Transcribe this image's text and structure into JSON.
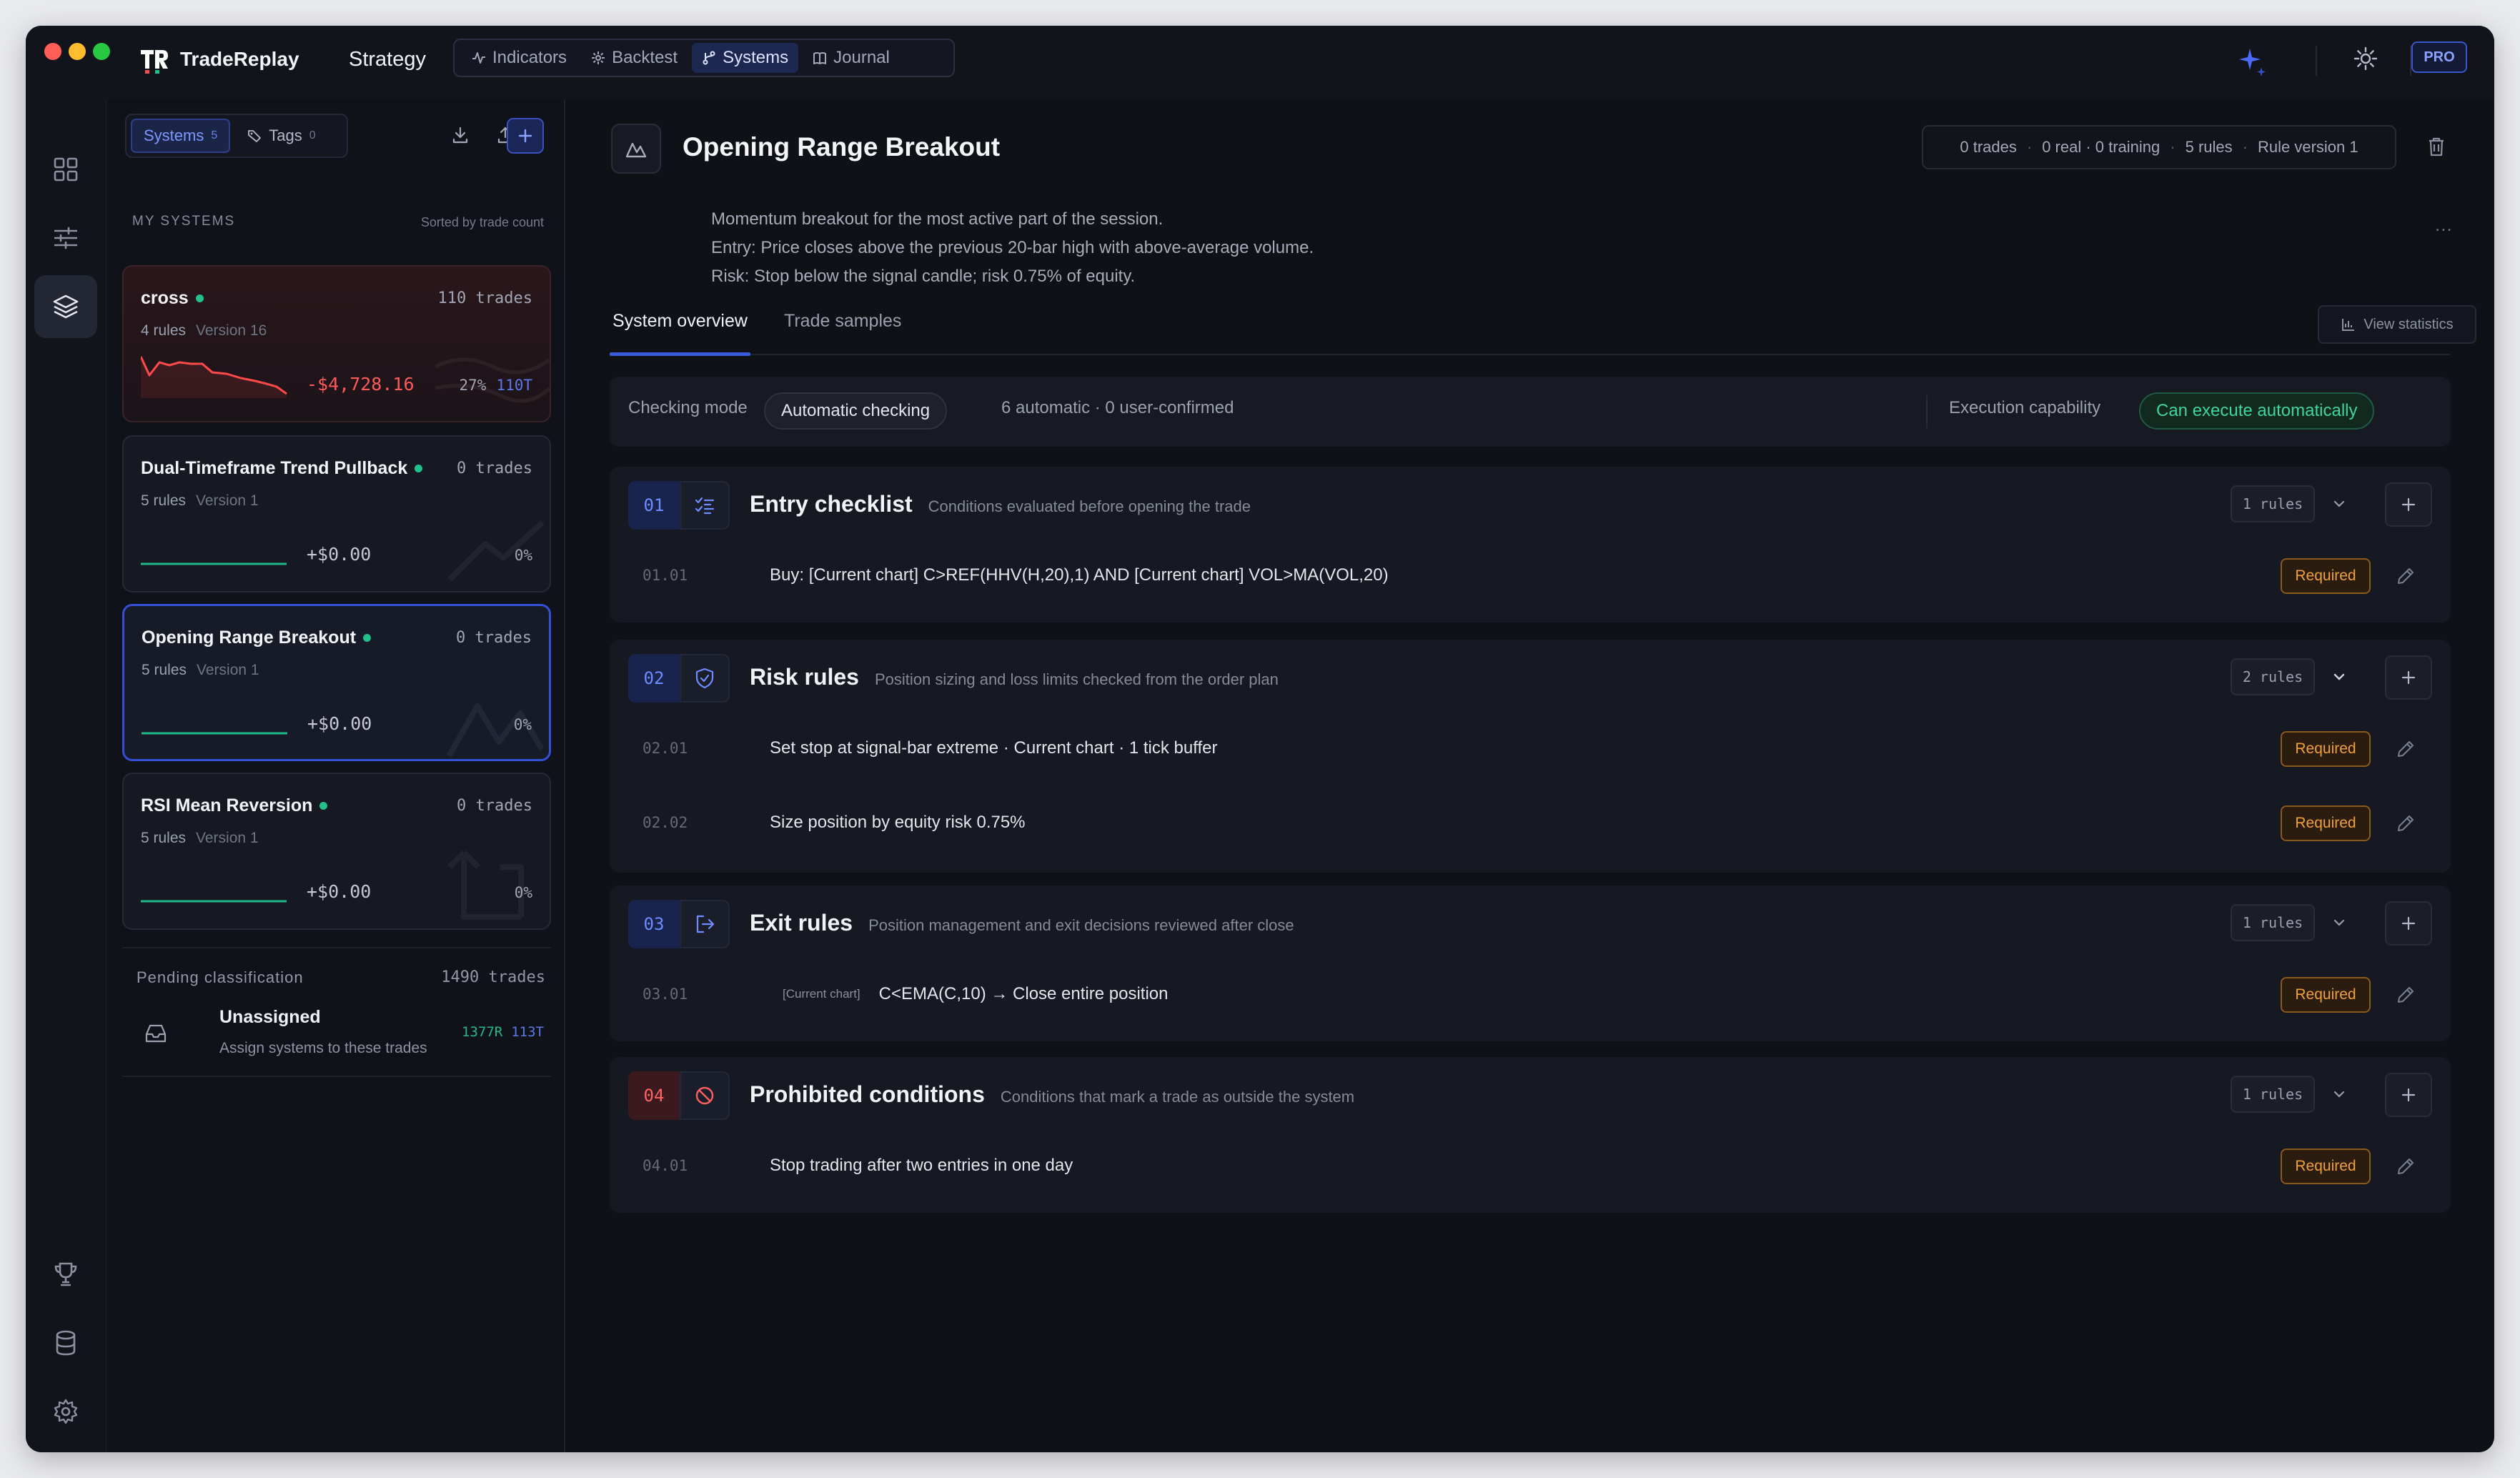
{
  "app": {
    "brand": "TradeReplay",
    "section": "Strategy",
    "badge": "PRO"
  },
  "nav": {
    "tabs": [
      {
        "label": "Indicators",
        "icon": "activity-icon"
      },
      {
        "label": "Backtest",
        "icon": "settings-spark-icon"
      },
      {
        "label": "Systems",
        "icon": "branch-icon",
        "active": true
      },
      {
        "label": "Journal",
        "icon": "book-icon"
      }
    ]
  },
  "sidebar": {
    "tabs": [
      {
        "label": "Systems",
        "count": "5",
        "active": true
      },
      {
        "label": "Tags",
        "count": "0"
      }
    ],
    "heading": "MY SYSTEMS",
    "sort_label": "Sorted by trade count",
    "systems": [
      {
        "name": "cross",
        "trades": "110 trades",
        "rules": "4 rules",
        "version": "Version 16",
        "pnl": "-$4,728.16",
        "pct": "27%",
        "tcount": "110T",
        "state": "loss"
      },
      {
        "name": "Dual-Timeframe Trend Pullback",
        "trades": "0 trades",
        "rules": "5 rules",
        "version": "Version 1",
        "pnl": "+$0.00",
        "pct": "0%",
        "state": "flat"
      },
      {
        "name": "Opening Range Breakout",
        "trades": "0 trades",
        "rules": "5 rules",
        "version": "Version 1",
        "pnl": "+$0.00",
        "pct": "0%",
        "state": "selected"
      },
      {
        "name": "RSI Mean Reversion",
        "trades": "0 trades",
        "rules": "5 rules",
        "version": "Version 1",
        "pnl": "+$0.00",
        "pct": "0%",
        "state": "flat"
      }
    ],
    "pending": {
      "label": "Pending classification",
      "count": "1490 trades",
      "title": "Unassigned",
      "subtitle": "Assign systems to these trades",
      "real": "1377R",
      "training": "113T"
    }
  },
  "main": {
    "title": "Opening Range Breakout",
    "meta": [
      "0 trades",
      "0 real · 0 training",
      "5 rules",
      "Rule version 1"
    ],
    "meta_sep": "·",
    "description": [
      "Momentum breakout for the most active part of the session.",
      "Entry: Price closes above the previous 20-bar high with above-average volume.",
      "Risk: Stop below the signal candle; risk 0.75% of equity."
    ],
    "more": "...",
    "tabs": [
      "System overview",
      "Trade samples"
    ],
    "view_stats": "View statistics",
    "mode": {
      "label": "Checking mode",
      "value": "Automatic checking",
      "counts": "6 automatic · 0 user-confirmed",
      "exec_label": "Execution capability",
      "exec_value": "Can execute automatically"
    },
    "sections": [
      {
        "num": "01",
        "title": "Entry checklist",
        "subtitle": "Conditions evaluated before opening the trade",
        "count": "1 rules",
        "icon": "checklist-icon",
        "rules": [
          {
            "num": "01.01",
            "text": "Buy: [Current chart] C>REF(HHV(H,20),1) AND [Current chart] VOL>MA(VOL,20)",
            "badge": "Required"
          }
        ]
      },
      {
        "num": "02",
        "title": "Risk rules",
        "subtitle": "Position sizing and loss limits checked from the order plan",
        "count": "2 rules",
        "icon": "shield-icon",
        "rules": [
          {
            "num": "02.01",
            "text": "Set stop at signal-bar extreme · Current chart · 1 tick buffer",
            "badge": "Required"
          },
          {
            "num": "02.02",
            "text": "Size position by equity risk 0.75%",
            "badge": "Required"
          }
        ]
      },
      {
        "num": "03",
        "title": "Exit rules",
        "subtitle": "Position management and exit decisions reviewed after close",
        "count": "1 rules",
        "icon": "exit-icon",
        "rules": [
          {
            "num": "03.01",
            "tag": "[Current chart]",
            "text": "C<EMA(C,10) → Close entire position",
            "badge": "Required"
          }
        ]
      },
      {
        "num": "04",
        "title": "Prohibited conditions",
        "subtitle": "Conditions that mark a trade as outside the system",
        "count": "1 rules",
        "icon": "ban-icon",
        "rules": [
          {
            "num": "04.01",
            "text": "Stop trading after two entries in one day",
            "badge": "Required"
          }
        ]
      }
    ]
  },
  "colors": {
    "accent": "#3b5bdb",
    "positive": "#22c08a",
    "negative": "#ff5a5a",
    "warning": "#f0a03a"
  }
}
